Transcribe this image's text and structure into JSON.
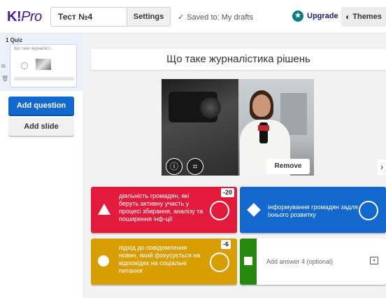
{
  "header": {
    "logo_k": "K!",
    "logo_pro": "Pro",
    "quiz_title": "Тест №4",
    "settings_label": "Settings",
    "saved_status": "Saved to: My drafts",
    "upgrade_label": "Upgrade",
    "themes_label": "Themes"
  },
  "sidebar": {
    "slide_label": "1  Quiz",
    "slide_thumb_title": "Що таке журналіст...",
    "add_question_label": "Add question",
    "add_slide_label": "Add slide"
  },
  "question": {
    "title": "Що таке журналістика рішень",
    "remove_label": "Remove"
  },
  "answers": [
    {
      "text": "діяльність громадян, які беруть активну участь у процесі збирання, аналізу та поширення інф-ції",
      "badge": "-20",
      "color": "#e21b3c",
      "shape": "triangle-icon"
    },
    {
      "text": "інформування громадян задля їхнього розвитку",
      "badge": "",
      "color": "#1368ce",
      "shape": "diamond-icon"
    },
    {
      "text": "підхід до повідомлення новин, який фокусується на відповідях на соціальні питання",
      "badge": "-6",
      "color": "#d89e00",
      "shape": "circle-icon"
    },
    {
      "text": "Add answer 4 (optional)",
      "badge": "",
      "color": "#26890c",
      "shape": "square-icon"
    }
  ],
  "colors": {
    "brand": "#46178f",
    "primary_button": "#1368ce"
  }
}
